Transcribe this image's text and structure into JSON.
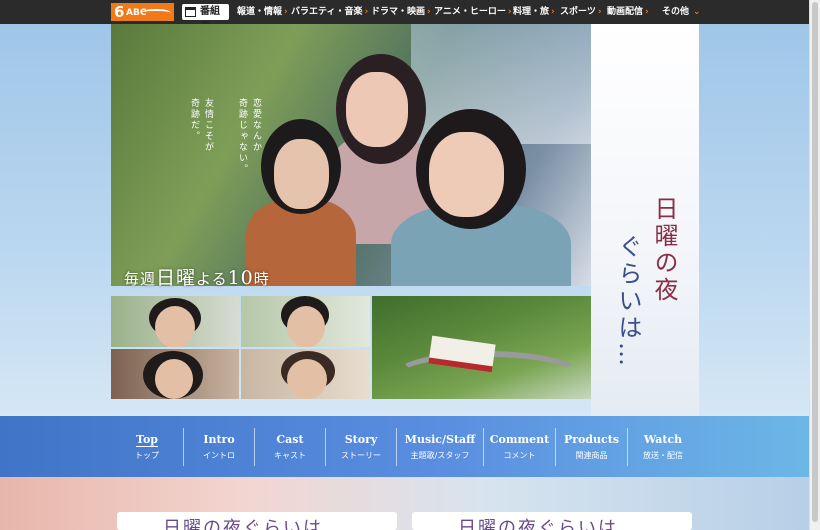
{
  "topbar": {
    "logo_number": "6",
    "logo_text": "ABC",
    "schedule_label": "番組表",
    "nav_items": [
      "報道・情報",
      "バラエティ・音楽",
      "ドラマ・映画",
      "アニメ・ヒーロー",
      "料理・旅",
      "スポーツ",
      "動画配信"
    ],
    "more_label": "その他"
  },
  "hero": {
    "tagline": [
      "恋愛なんか",
      "奇跡じゃない。",
      "友情こそが",
      "奇跡だ。"
    ],
    "weekly_small1": "毎週",
    "weekly_big1": "日曜",
    "weekly_small2": "よる",
    "weekly_big2": "10",
    "weekly_small3": "時",
    "title_right": "日曜の夜",
    "title_left": "ぐらいは…"
  },
  "tabs": [
    {
      "en": "Top",
      "jp": "トップ"
    },
    {
      "en": "Intro",
      "jp": "イントロ"
    },
    {
      "en": "Cast",
      "jp": "キャスト"
    },
    {
      "en": "Story",
      "jp": "ストーリー"
    },
    {
      "en": "Music/Staff",
      "jp": "主題歌/スタッフ"
    },
    {
      "en": "Comment",
      "jp": "コメント"
    },
    {
      "en": "Products",
      "jp": "関連商品"
    },
    {
      "en": "Watch",
      "jp": "放送・配信"
    }
  ],
  "cards": [
    {
      "title": "日曜の夜ぐらいは"
    },
    {
      "title": "日曜の夜ぐらいは"
    }
  ],
  "colors": {
    "accent": "#f07a1a",
    "topbar": "#2b2b2b",
    "tabbar": "#4a80d4"
  }
}
